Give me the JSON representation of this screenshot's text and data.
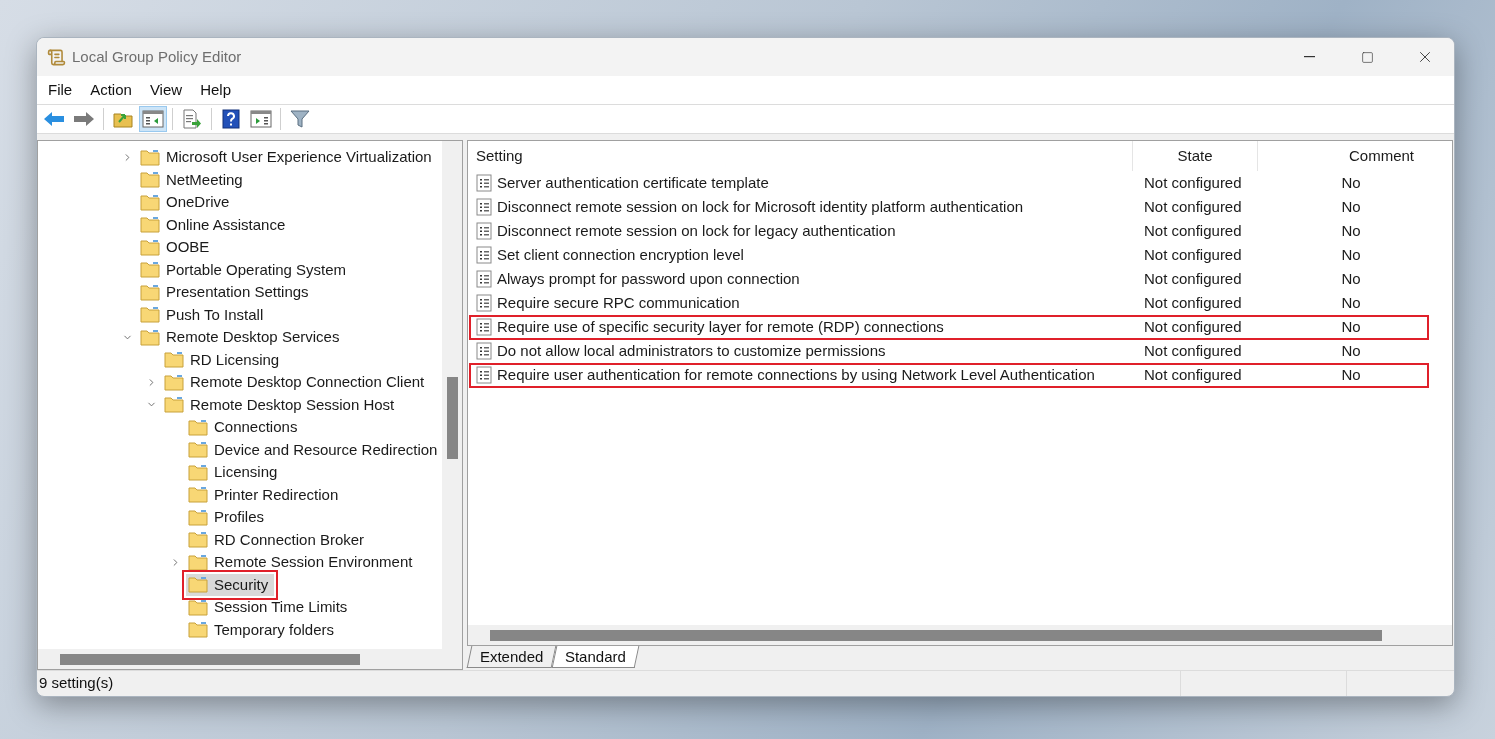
{
  "window": {
    "title": "Local Group Policy Editor"
  },
  "menu": [
    "File",
    "Action",
    "View",
    "Help"
  ],
  "toolbar": [
    {
      "kind": "back",
      "pressed": false
    },
    {
      "kind": "forward",
      "pressed": false
    },
    {
      "kind": "sep"
    },
    {
      "kind": "up",
      "pressed": false
    },
    {
      "kind": "tree",
      "pressed": true
    },
    {
      "kind": "sep"
    },
    {
      "kind": "export",
      "pressed": false
    },
    {
      "kind": "sep"
    },
    {
      "kind": "help",
      "pressed": false
    },
    {
      "kind": "pane",
      "pressed": false
    },
    {
      "kind": "sep"
    },
    {
      "kind": "filter",
      "pressed": false
    }
  ],
  "tree": [
    {
      "label": "Microsoft User Experience Virtualization",
      "expanded": false,
      "selected": false,
      "annotated": false
    },
    {
      "label": "NetMeeting",
      "selected": false,
      "annotated": false
    },
    {
      "label": "OneDrive",
      "selected": false,
      "annotated": false
    },
    {
      "label": "Online Assistance",
      "selected": false,
      "annotated": false
    },
    {
      "label": "OOBE",
      "selected": false,
      "annotated": false
    },
    {
      "label": "Portable Operating System",
      "selected": false,
      "annotated": false
    },
    {
      "label": "Presentation Settings",
      "selected": false,
      "annotated": false
    },
    {
      "label": "Push To Install",
      "selected": false,
      "annotated": false
    },
    {
      "label": "Remote Desktop Services",
      "expanded": true,
      "selected": false,
      "annotated": false,
      "children": [
        {
          "label": "RD Licensing",
          "selected": false,
          "annotated": false
        },
        {
          "label": "Remote Desktop Connection Client",
          "expanded": false,
          "selected": false,
          "annotated": false
        },
        {
          "label": "Remote Desktop Session Host",
          "expanded": true,
          "selected": false,
          "annotated": false,
          "children": [
            {
              "label": "Connections",
              "selected": false,
              "annotated": false
            },
            {
              "label": "Device and Resource Redirection",
              "selected": false,
              "annotated": false
            },
            {
              "label": "Licensing",
              "selected": false,
              "annotated": false
            },
            {
              "label": "Printer Redirection",
              "selected": false,
              "annotated": false
            },
            {
              "label": "Profiles",
              "selected": false,
              "annotated": false
            },
            {
              "label": "RD Connection Broker",
              "selected": false,
              "annotated": false
            },
            {
              "label": "Remote Session Environment",
              "expanded": false,
              "selected": false,
              "annotated": false
            },
            {
              "label": "Security",
              "selected": true,
              "annotated": true
            },
            {
              "label": "Session Time Limits",
              "selected": false,
              "annotated": false
            },
            {
              "label": "Temporary folders",
              "selected": false,
              "annotated": false
            }
          ]
        }
      ]
    }
  ],
  "table": {
    "columns": [
      "Setting",
      "State",
      "Comment"
    ],
    "rows": [
      {
        "setting": "Server authentication certificate template",
        "state": "Not configured",
        "comment": "No",
        "annotated": false
      },
      {
        "setting": "Disconnect remote session on lock for Microsoft identity platform authentication",
        "state": "Not configured",
        "comment": "No",
        "annotated": false
      },
      {
        "setting": "Disconnect remote session on lock for legacy authentication",
        "state": "Not configured",
        "comment": "No",
        "annotated": false
      },
      {
        "setting": "Set client connection encryption level",
        "state": "Not configured",
        "comment": "No",
        "annotated": false
      },
      {
        "setting": "Always prompt for password upon connection",
        "state": "Not configured",
        "comment": "No",
        "annotated": false
      },
      {
        "setting": "Require secure RPC communication",
        "state": "Not configured",
        "comment": "No",
        "annotated": false
      },
      {
        "setting": "Require use of specific security layer for remote (RDP) connections",
        "state": "Not configured",
        "comment": "No",
        "annotated": true
      },
      {
        "setting": "Do not allow local administrators to customize permissions",
        "state": "Not configured",
        "comment": "No",
        "annotated": false
      },
      {
        "setting": "Require user authentication for remote connections by using Network Level Authentication",
        "state": "Not configured",
        "comment": "No",
        "annotated": true
      }
    ]
  },
  "tabs": [
    {
      "label": "Extended",
      "selected": false
    },
    {
      "label": "Standard",
      "selected": true
    }
  ],
  "status_bar": "9 setting(s)"
}
